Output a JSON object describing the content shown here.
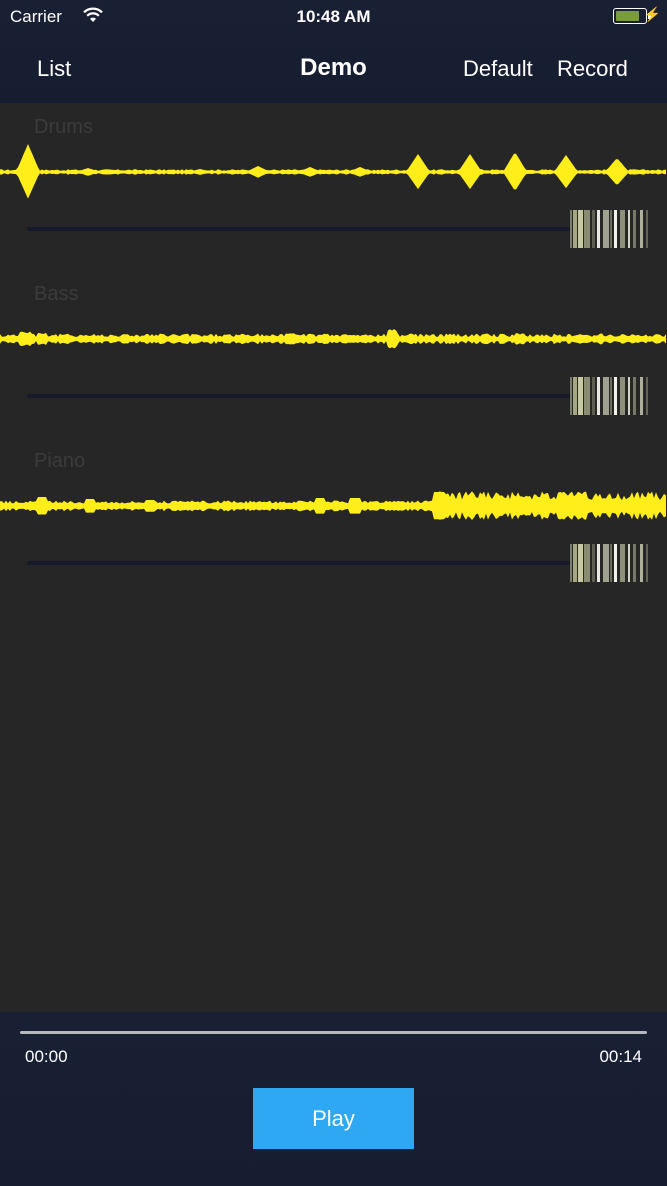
{
  "status": {
    "carrier": "Carrier",
    "time": "10:48 AM",
    "battery_level": 0.9
  },
  "nav": {
    "left": "List",
    "title": "Demo",
    "default": "Default",
    "record": "Record"
  },
  "colors": {
    "waveform": "#ffee1a",
    "nav_bg": "#1a2034",
    "content_bg": "#262626",
    "play_bg": "#2ea8f2"
  },
  "tracks": [
    {
      "name": "Drums"
    },
    {
      "name": "Bass"
    },
    {
      "name": "Piano"
    }
  ],
  "transport": {
    "current_time": "00:00",
    "duration": "00:14",
    "play_label": "Play",
    "progress": 0
  }
}
